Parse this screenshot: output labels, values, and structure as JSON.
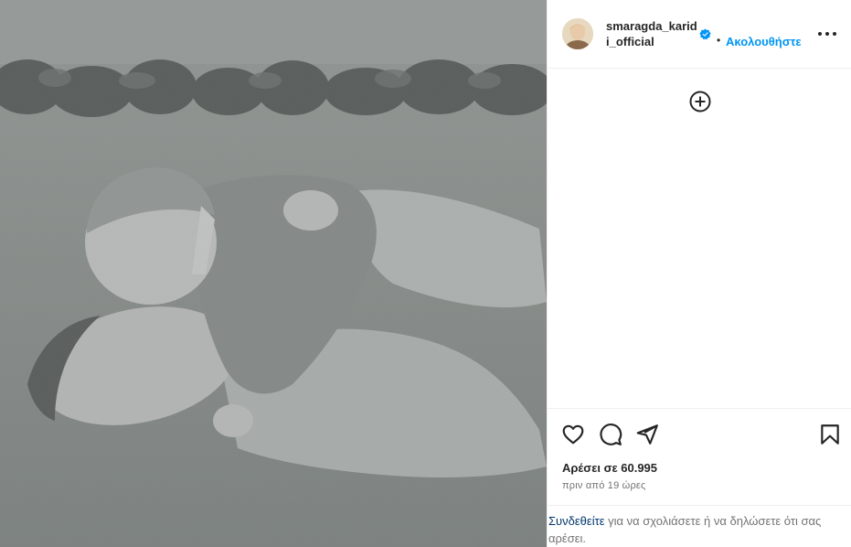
{
  "post": {
    "image_icon": "black-and-white-photo-father-and-toddler-on-grass"
  },
  "header": {
    "username": "smaragda_karidi_official",
    "avatar_icon": "avatar-image",
    "verified_icon": "verified-badge-icon",
    "separator": "•",
    "follow_label": "Ακολουθήστε",
    "more_icon": "more-options-icon"
  },
  "comments": {
    "add_icon": "plus-circle-icon"
  },
  "actions": {
    "like_icon": "heart-icon",
    "comment_icon": "comment-bubble-icon",
    "share_icon": "paper-plane-icon",
    "save_icon": "bookmark-icon",
    "likes_text": "Αρέσει σε 60.995",
    "time_text": "πριν από 19 ώρες"
  },
  "login_prompt": {
    "link_text": "Συνδεθείτε",
    "rest_text": " για να σχολιάσετε ή να δηλώσετε ότι σας αρέσει."
  },
  "colors": {
    "accent": "#0095f6",
    "link_dark": "#00376b",
    "text": "#262626",
    "muted": "#737373"
  }
}
